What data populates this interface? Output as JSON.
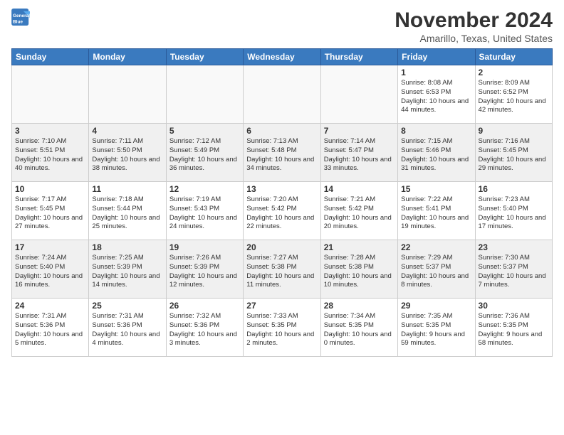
{
  "logo": {
    "line1": "General",
    "line2": "Blue"
  },
  "header": {
    "month": "November 2024",
    "location": "Amarillo, Texas, United States"
  },
  "weekdays": [
    "Sunday",
    "Monday",
    "Tuesday",
    "Wednesday",
    "Thursday",
    "Friday",
    "Saturday"
  ],
  "weeks": [
    [
      {
        "day": "",
        "empty": true
      },
      {
        "day": "",
        "empty": true
      },
      {
        "day": "",
        "empty": true
      },
      {
        "day": "",
        "empty": true
      },
      {
        "day": "",
        "empty": true
      },
      {
        "day": "1",
        "sunrise": "Sunrise: 8:08 AM",
        "sunset": "Sunset: 6:53 PM",
        "daylight": "Daylight: 10 hours and 44 minutes."
      },
      {
        "day": "2",
        "sunrise": "Sunrise: 8:09 AM",
        "sunset": "Sunset: 6:52 PM",
        "daylight": "Daylight: 10 hours and 42 minutes."
      }
    ],
    [
      {
        "day": "3",
        "sunrise": "Sunrise: 7:10 AM",
        "sunset": "Sunset: 5:51 PM",
        "daylight": "Daylight: 10 hours and 40 minutes."
      },
      {
        "day": "4",
        "sunrise": "Sunrise: 7:11 AM",
        "sunset": "Sunset: 5:50 PM",
        "daylight": "Daylight: 10 hours and 38 minutes."
      },
      {
        "day": "5",
        "sunrise": "Sunrise: 7:12 AM",
        "sunset": "Sunset: 5:49 PM",
        "daylight": "Daylight: 10 hours and 36 minutes."
      },
      {
        "day": "6",
        "sunrise": "Sunrise: 7:13 AM",
        "sunset": "Sunset: 5:48 PM",
        "daylight": "Daylight: 10 hours and 34 minutes."
      },
      {
        "day": "7",
        "sunrise": "Sunrise: 7:14 AM",
        "sunset": "Sunset: 5:47 PM",
        "daylight": "Daylight: 10 hours and 33 minutes."
      },
      {
        "day": "8",
        "sunrise": "Sunrise: 7:15 AM",
        "sunset": "Sunset: 5:46 PM",
        "daylight": "Daylight: 10 hours and 31 minutes."
      },
      {
        "day": "9",
        "sunrise": "Sunrise: 7:16 AM",
        "sunset": "Sunset: 5:45 PM",
        "daylight": "Daylight: 10 hours and 29 minutes."
      }
    ],
    [
      {
        "day": "10",
        "sunrise": "Sunrise: 7:17 AM",
        "sunset": "Sunset: 5:45 PM",
        "daylight": "Daylight: 10 hours and 27 minutes."
      },
      {
        "day": "11",
        "sunrise": "Sunrise: 7:18 AM",
        "sunset": "Sunset: 5:44 PM",
        "daylight": "Daylight: 10 hours and 25 minutes."
      },
      {
        "day": "12",
        "sunrise": "Sunrise: 7:19 AM",
        "sunset": "Sunset: 5:43 PM",
        "daylight": "Daylight: 10 hours and 24 minutes."
      },
      {
        "day": "13",
        "sunrise": "Sunrise: 7:20 AM",
        "sunset": "Sunset: 5:42 PM",
        "daylight": "Daylight: 10 hours and 22 minutes."
      },
      {
        "day": "14",
        "sunrise": "Sunrise: 7:21 AM",
        "sunset": "Sunset: 5:42 PM",
        "daylight": "Daylight: 10 hours and 20 minutes."
      },
      {
        "day": "15",
        "sunrise": "Sunrise: 7:22 AM",
        "sunset": "Sunset: 5:41 PM",
        "daylight": "Daylight: 10 hours and 19 minutes."
      },
      {
        "day": "16",
        "sunrise": "Sunrise: 7:23 AM",
        "sunset": "Sunset: 5:40 PM",
        "daylight": "Daylight: 10 hours and 17 minutes."
      }
    ],
    [
      {
        "day": "17",
        "sunrise": "Sunrise: 7:24 AM",
        "sunset": "Sunset: 5:40 PM",
        "daylight": "Daylight: 10 hours and 16 minutes."
      },
      {
        "day": "18",
        "sunrise": "Sunrise: 7:25 AM",
        "sunset": "Sunset: 5:39 PM",
        "daylight": "Daylight: 10 hours and 14 minutes."
      },
      {
        "day": "19",
        "sunrise": "Sunrise: 7:26 AM",
        "sunset": "Sunset: 5:39 PM",
        "daylight": "Daylight: 10 hours and 12 minutes."
      },
      {
        "day": "20",
        "sunrise": "Sunrise: 7:27 AM",
        "sunset": "Sunset: 5:38 PM",
        "daylight": "Daylight: 10 hours and 11 minutes."
      },
      {
        "day": "21",
        "sunrise": "Sunrise: 7:28 AM",
        "sunset": "Sunset: 5:38 PM",
        "daylight": "Daylight: 10 hours and 10 minutes."
      },
      {
        "day": "22",
        "sunrise": "Sunrise: 7:29 AM",
        "sunset": "Sunset: 5:37 PM",
        "daylight": "Daylight: 10 hours and 8 minutes."
      },
      {
        "day": "23",
        "sunrise": "Sunrise: 7:30 AM",
        "sunset": "Sunset: 5:37 PM",
        "daylight": "Daylight: 10 hours and 7 minutes."
      }
    ],
    [
      {
        "day": "24",
        "sunrise": "Sunrise: 7:31 AM",
        "sunset": "Sunset: 5:36 PM",
        "daylight": "Daylight: 10 hours and 5 minutes."
      },
      {
        "day": "25",
        "sunrise": "Sunrise: 7:31 AM",
        "sunset": "Sunset: 5:36 PM",
        "daylight": "Daylight: 10 hours and 4 minutes."
      },
      {
        "day": "26",
        "sunrise": "Sunrise: 7:32 AM",
        "sunset": "Sunset: 5:36 PM",
        "daylight": "Daylight: 10 hours and 3 minutes."
      },
      {
        "day": "27",
        "sunrise": "Sunrise: 7:33 AM",
        "sunset": "Sunset: 5:35 PM",
        "daylight": "Daylight: 10 hours and 2 minutes."
      },
      {
        "day": "28",
        "sunrise": "Sunrise: 7:34 AM",
        "sunset": "Sunset: 5:35 PM",
        "daylight": "Daylight: 10 hours and 0 minutes."
      },
      {
        "day": "29",
        "sunrise": "Sunrise: 7:35 AM",
        "sunset": "Sunset: 5:35 PM",
        "daylight": "Daylight: 9 hours and 59 minutes."
      },
      {
        "day": "30",
        "sunrise": "Sunrise: 7:36 AM",
        "sunset": "Sunset: 5:35 PM",
        "daylight": "Daylight: 9 hours and 58 minutes."
      }
    ]
  ]
}
